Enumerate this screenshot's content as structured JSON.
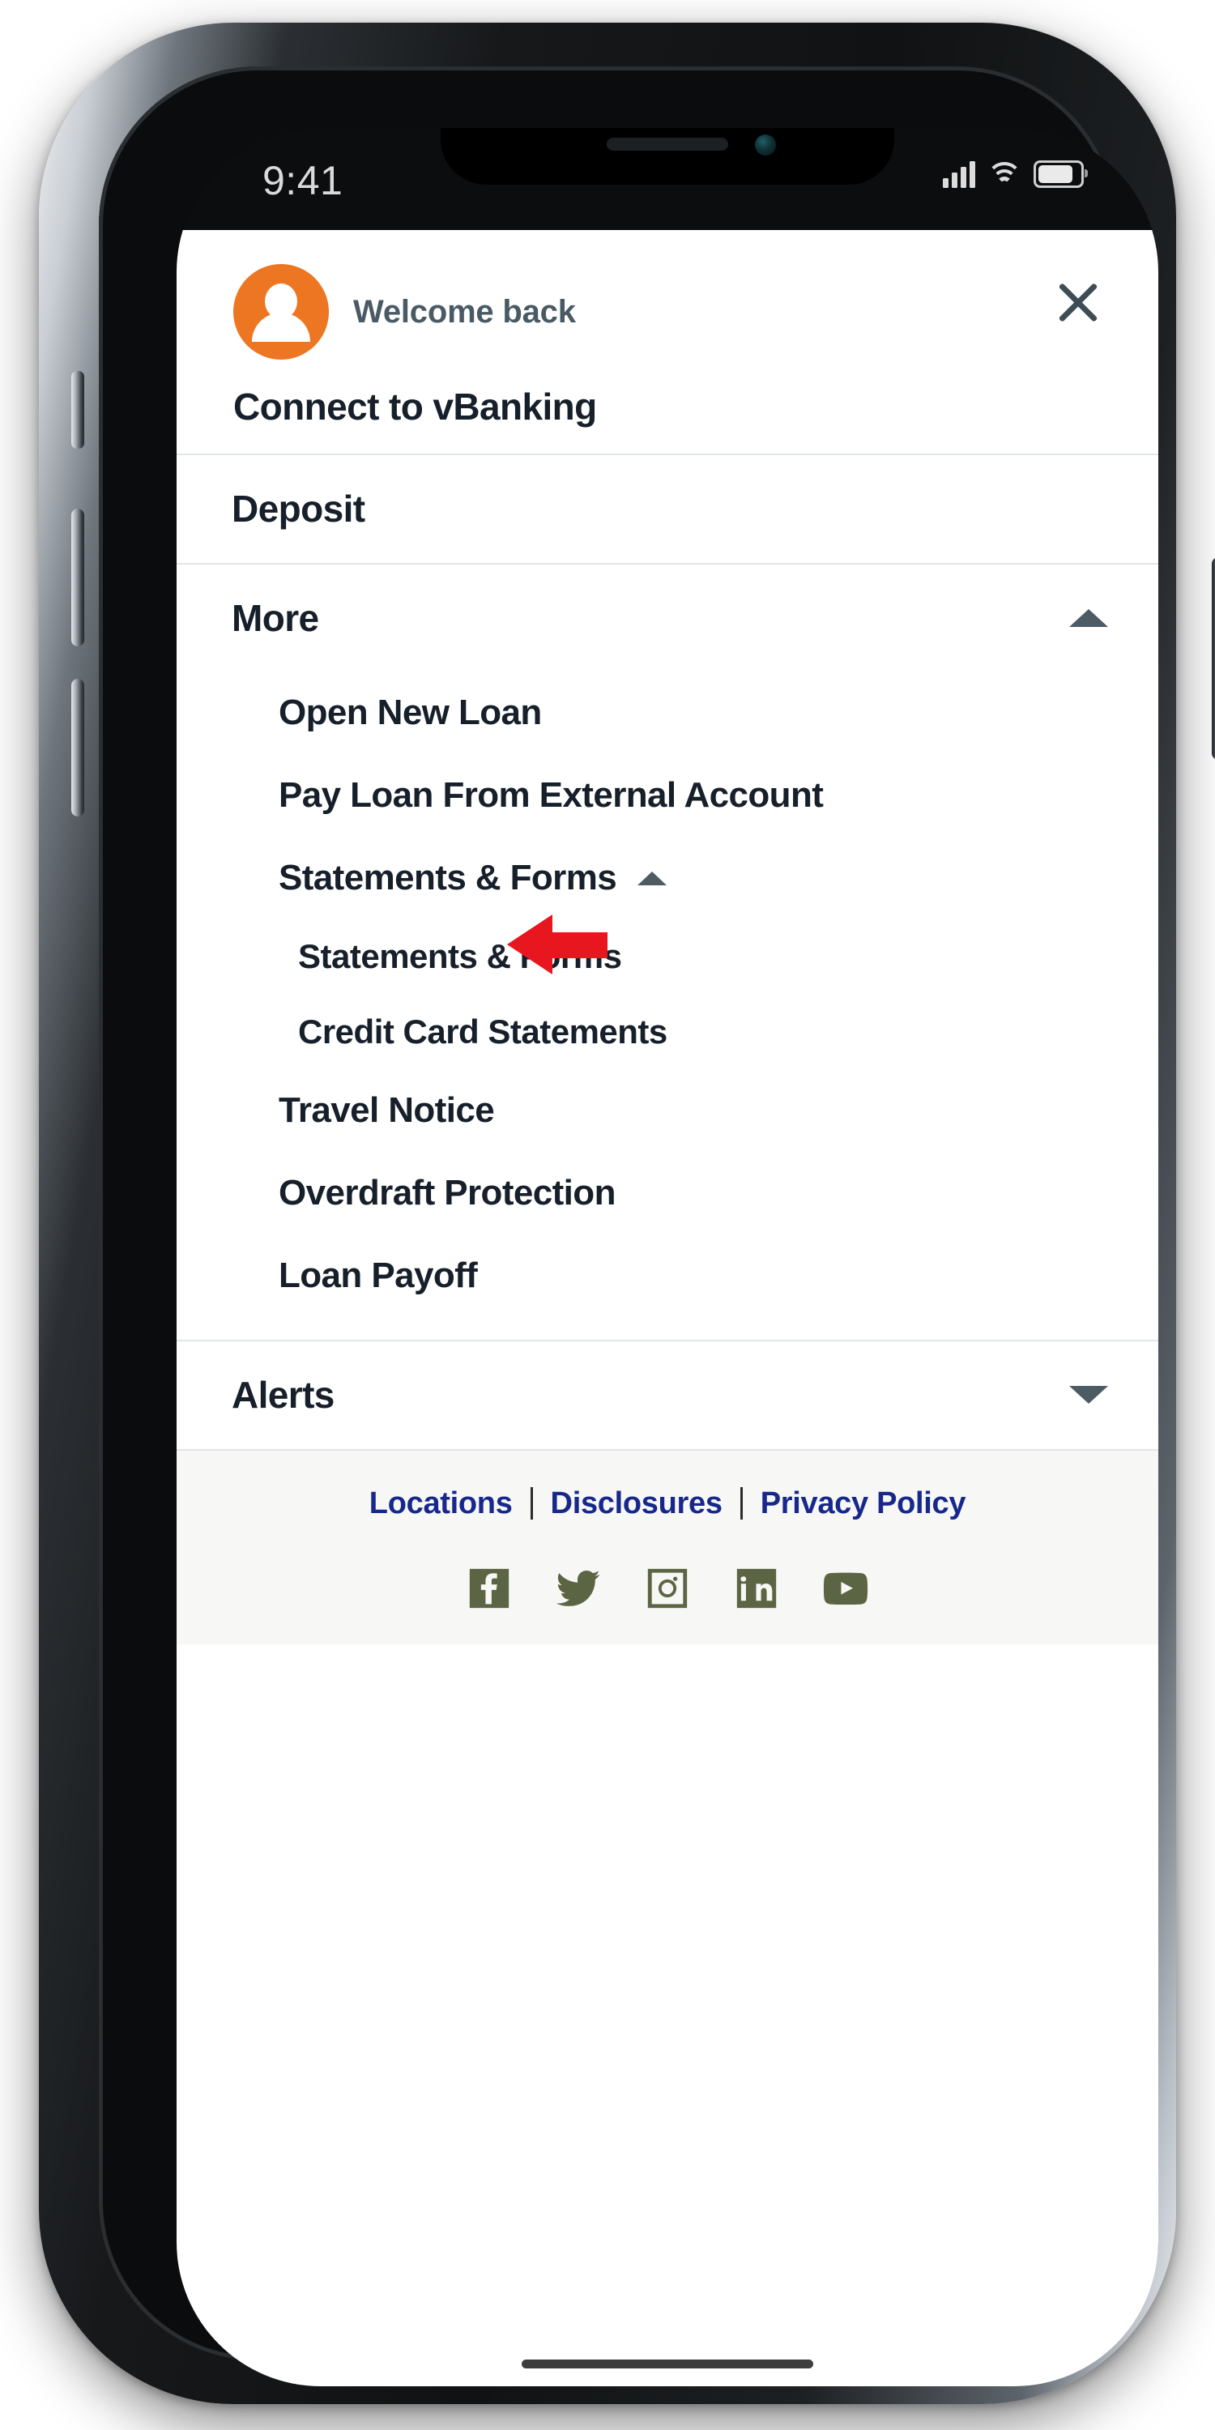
{
  "status_bar": {
    "time": "9:41",
    "signal_icon": "cellular-signal-icon",
    "wifi_icon": "wifi-icon",
    "battery_icon": "battery-icon"
  },
  "header": {
    "avatar_icon": "user-avatar-icon",
    "welcome_text": "Welcome back",
    "close_icon": "close-icon"
  },
  "menu": [
    {
      "label": "Connect to vBanking",
      "level": 0,
      "chevron": "none"
    },
    {
      "label": "Deposit",
      "level": 0,
      "chevron": "none"
    },
    {
      "label": "More",
      "level": 0,
      "chevron": "up"
    }
  ],
  "more_items": [
    {
      "label": "Open New Loan",
      "level": 1,
      "chevron": "none"
    },
    {
      "label": "Pay Loan From External Account",
      "level": 1,
      "chevron": "none"
    },
    {
      "label": "Statements & Forms",
      "level": 1,
      "chevron": "up"
    }
  ],
  "statements_children": [
    {
      "label": "Statements & Forms",
      "level": 2,
      "highlighted": true
    },
    {
      "label": "Credit Card Statements",
      "level": 2,
      "highlighted": false
    }
  ],
  "more_items_rest": [
    {
      "label": "Travel Notice",
      "level": 1,
      "chevron": "none"
    },
    {
      "label": "Overdraft Protection",
      "level": 1,
      "chevron": "none"
    },
    {
      "label": "Loan Payoff",
      "level": 1,
      "chevron": "none"
    }
  ],
  "alerts": {
    "label": "Alerts",
    "chevron": "down"
  },
  "annotation": {
    "arrow_icon": "red-left-arrow-annotation",
    "arrow_color": "#E8161F",
    "points_to": "Statements & Forms"
  },
  "footer": {
    "links": [
      {
        "label": "Locations"
      },
      {
        "label": "Disclosures"
      },
      {
        "label": "Privacy Policy"
      }
    ],
    "separator": "|",
    "link_color": "#16288C",
    "socials": [
      {
        "name": "facebook-icon"
      },
      {
        "name": "twitter-icon"
      },
      {
        "name": "instagram-icon"
      },
      {
        "name": "linkedin-icon"
      },
      {
        "name": "youtube-icon"
      }
    ],
    "social_color": "#5C6543"
  },
  "theme": {
    "avatar_orange": "#ED7623",
    "text_dark": "#17202A",
    "welcome_slate": "#4A5A64",
    "divider": "#E2E6E8",
    "footer_bg": "#F7F7F5"
  }
}
